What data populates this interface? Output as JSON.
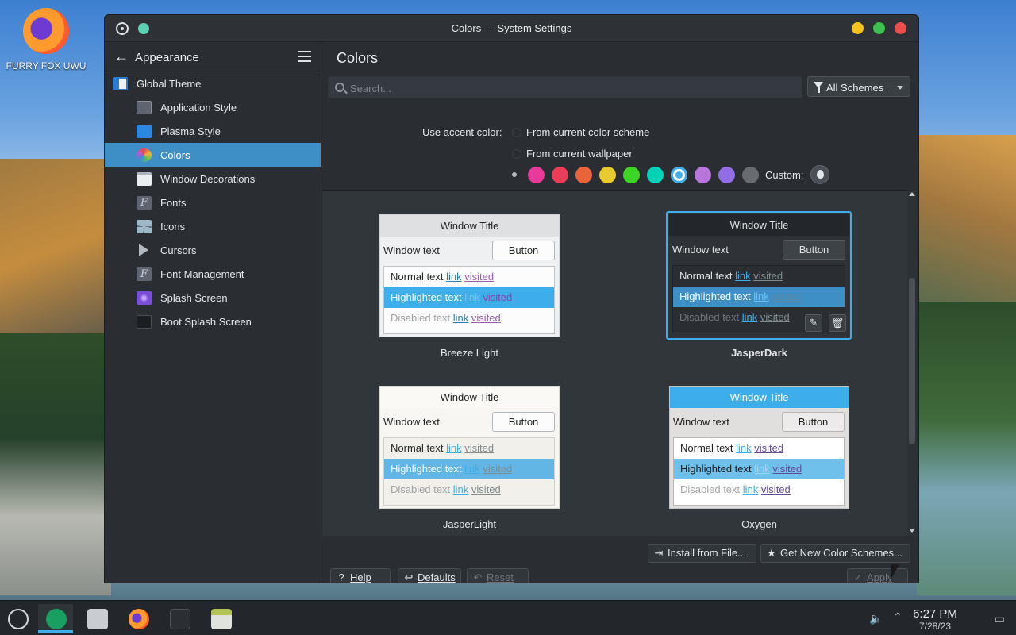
{
  "desktop": {
    "icon_label": "FURRY FOX UWU"
  },
  "window": {
    "title": "Colors — System Settings"
  },
  "sidebar": {
    "header": "Appearance",
    "items": [
      {
        "label": "Global Theme",
        "level": 1,
        "icon": "global-theme-icon"
      },
      {
        "label": "Application Style",
        "level": 2,
        "icon": "application-style-icon"
      },
      {
        "label": "Plasma Style",
        "level": 2,
        "icon": "plasma-style-icon"
      },
      {
        "label": "Colors",
        "level": 2,
        "icon": "colors-icon",
        "active": true
      },
      {
        "label": "Window Decorations",
        "level": 2,
        "icon": "window-decorations-icon"
      },
      {
        "label": "Fonts",
        "level": 2,
        "icon": "fonts-icon"
      },
      {
        "label": "Icons",
        "level": 2,
        "icon": "icons-icon"
      },
      {
        "label": "Cursors",
        "level": 2,
        "icon": "cursors-icon"
      },
      {
        "label": "Font Management",
        "level": 2,
        "icon": "font-management-icon"
      },
      {
        "label": "Splash Screen",
        "level": 2,
        "icon": "splash-screen-icon"
      },
      {
        "label": "Boot Splash Screen",
        "level": 2,
        "icon": "boot-splash-screen-icon"
      }
    ]
  },
  "content": {
    "title": "Colors",
    "search_placeholder": "Search...",
    "filter_label": "All Schemes",
    "accent": {
      "label": "Use accent color:",
      "option1": "From current color scheme",
      "option2": "From current wallpaper",
      "custom_label": "Custom:",
      "swatches": [
        "#e93a9a",
        "#e93d58",
        "#e9643a",
        "#e8cb2d",
        "#3dd425",
        "#00d3b8",
        "#3daee9",
        "#b875dc",
        "#926ee4",
        "#686b6f"
      ],
      "selected_swatch": "#3daee9"
    },
    "schemes": [
      {
        "name": "Breeze Light",
        "window_title": "Window Title",
        "window_text": "Window text",
        "button": "Button",
        "normal": "Normal text",
        "highlighted": "Highlighted text",
        "disabled": "Disabled text",
        "link": "link",
        "visited": "visited"
      },
      {
        "name": "JasperDark",
        "window_title": "Window Title",
        "window_text": "Window text",
        "button": "Button",
        "normal": "Normal text",
        "highlighted": "Highlighted text",
        "disabled": "Disabled text",
        "link": "link",
        "visited": "visited"
      },
      {
        "name": "JasperLight",
        "window_title": "Window Title",
        "window_text": "Window text",
        "button": "Button",
        "normal": "Normal text",
        "highlighted": "Highlighted text",
        "disabled": "Disabled text",
        "link": "link",
        "visited": "visited"
      },
      {
        "name": "Oxygen",
        "window_title": "Window Title",
        "window_text": "Window text",
        "button": "Button",
        "normal": "Normal text",
        "highlighted": "Highlighted text",
        "disabled": "Disabled text",
        "link": "link",
        "visited": "visited"
      }
    ],
    "selected_scheme": "JasperDark"
  },
  "buttons": {
    "install": "Install from File...",
    "get_new": "Get New Color Schemes...",
    "help": "Help",
    "defaults": "Defaults",
    "reset": "Reset",
    "apply": "Apply"
  },
  "taskbar": {
    "time": "6:27 PM",
    "date": "7/28/23"
  }
}
